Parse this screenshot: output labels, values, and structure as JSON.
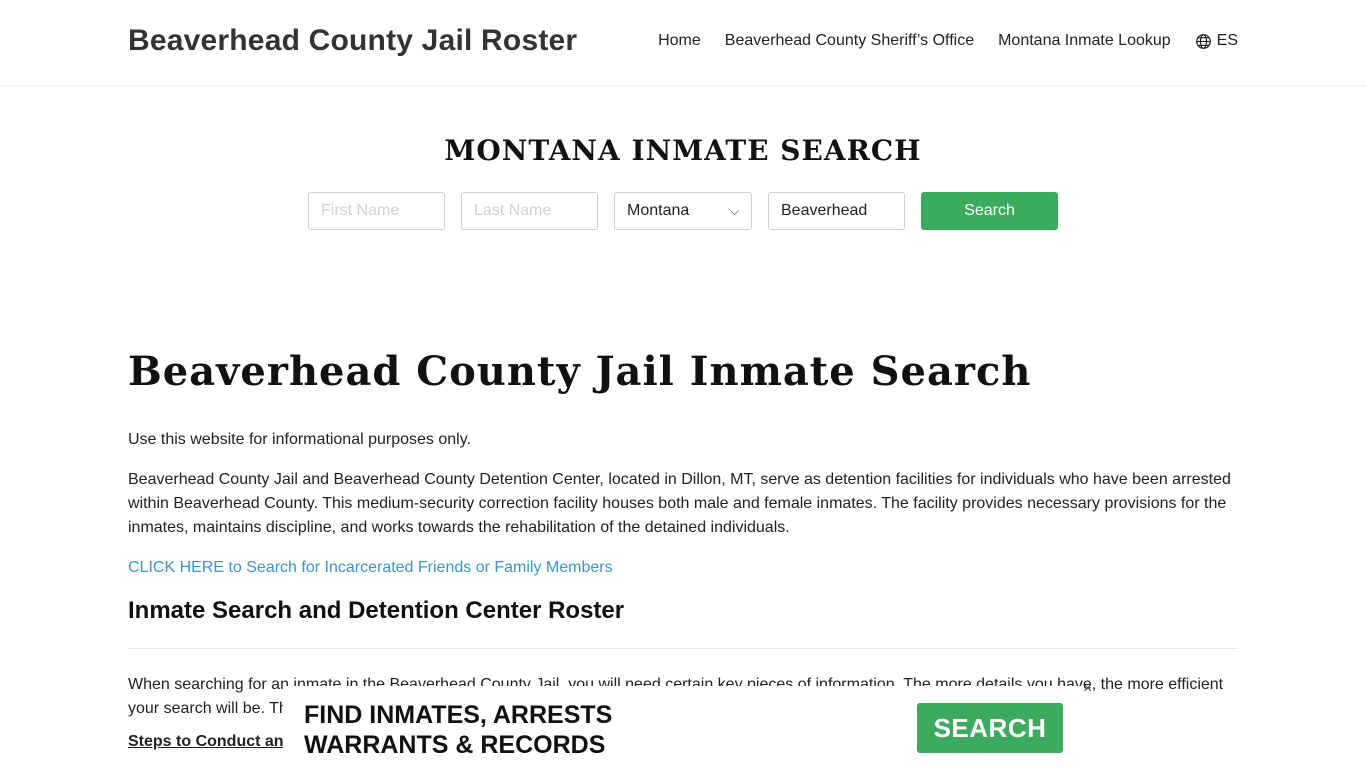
{
  "header": {
    "brand": "Beaverhead County Jail Roster",
    "nav": {
      "home": "Home",
      "sheriff": "Beaverhead County Sheriff’s Office",
      "lookup": "Montana Inmate Lookup",
      "lang": "ES"
    }
  },
  "search": {
    "title": "MONTANA INMATE SEARCH",
    "first_name_placeholder": "First Name",
    "last_name_placeholder": "Last Name",
    "state_value": "Montana",
    "county_value": "Beaverhead",
    "button_label": "Search"
  },
  "content": {
    "title": "Beaverhead County Jail Inmate Search",
    "disclaimer": "Use this website for informational purposes only.",
    "intro": "Beaverhead County Jail and Beaverhead County Detention Center, located in Dillon, MT, serve as detention facilities for individuals who have been arrested within Beaverhead County. This medium-security correction facility houses both male and female inmates. The facility provides necessary provisions for the inmates, maintains discipline, and works towards the rehabilitation of the detained individuals.",
    "cta_link": "CLICK HERE to Search for Incarcerated Friends or Family Members",
    "section_heading": "Inmate Search and Detention Center Roster",
    "section_para": "When searching for an inmate in the Beaverhead County Jail, you will need certain key pieces of information. The more details you have, the more efficient your search will be. The roster includes detailed inmate records.",
    "steps_heading": "Steps to Conduct an"
  },
  "ad": {
    "line1": "FIND INMATES, ARRESTS",
    "line2": "WARRANTS & RECORDS",
    "button_label": "SEARCH",
    "close": "×"
  },
  "colors": {
    "accent_green": "#3cab5f",
    "link_blue": "#3a96c9"
  }
}
